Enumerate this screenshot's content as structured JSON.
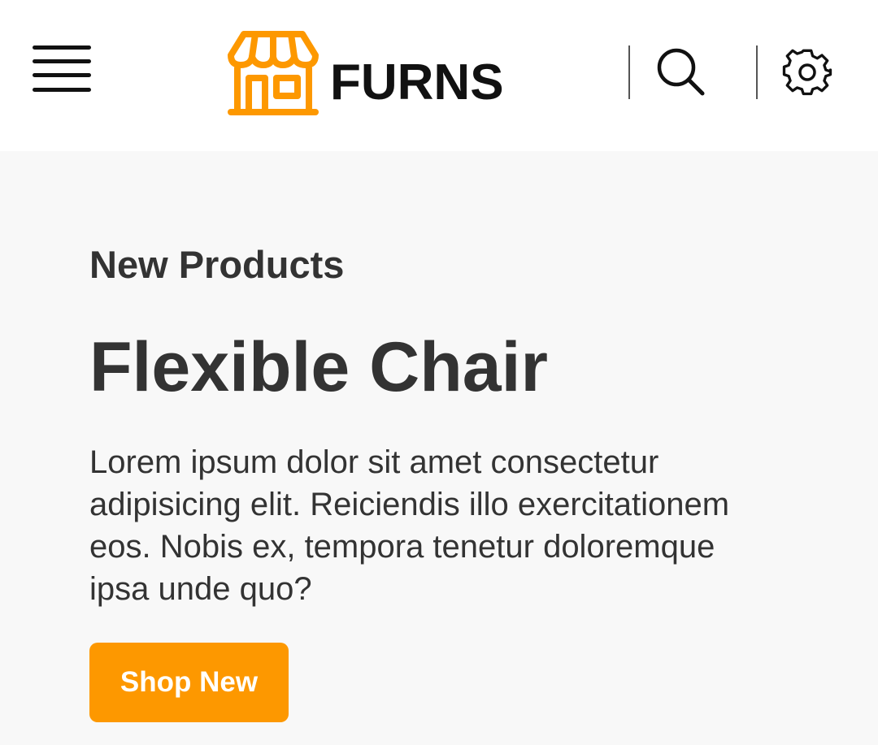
{
  "header": {
    "brand_name": "FURNS",
    "accent_color": "#fd9800",
    "icons": [
      "menu-icon",
      "storefront-logo-icon",
      "search-icon",
      "gear-icon"
    ]
  },
  "hero": {
    "kicker": "New Products",
    "title": "Flexible Chair",
    "description": "Lorem ipsum dolor sit amet consectetur adipisicing elit. Reiciendis illo exercitationem eos. Nobis ex, tempora tenetur doloremque ipsa unde quo?",
    "cta_label": "Shop New"
  }
}
